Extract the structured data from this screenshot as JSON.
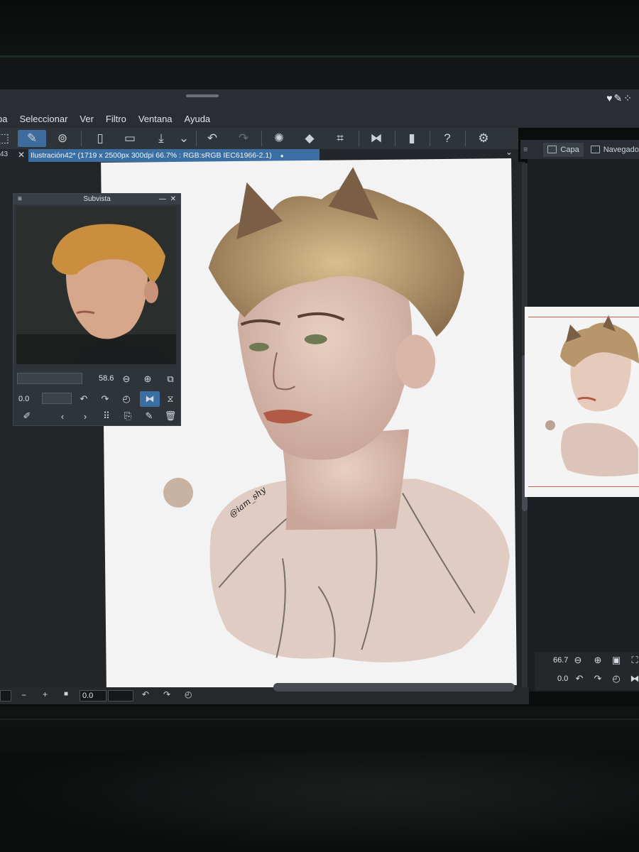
{
  "app": {
    "menu": [
      "pa",
      "Seleccionar",
      "Ver",
      "Filtro",
      "Ventana",
      "Ayuda"
    ]
  },
  "document": {
    "tab_number": "43",
    "tab_title": "Ilustración42* (1719 x 2500px 300dpi 66.7% : RGB:sRGB IEC61966-2.1)"
  },
  "right_panel": {
    "tabs": [
      "Capa",
      "Navegador"
    ],
    "zoom_value": "66.7",
    "rotation_value": "0.0"
  },
  "subview": {
    "title": "Subvista",
    "zoom_value": "58.6",
    "rotation_value": "0.0"
  },
  "statusbar": {
    "minus": "−",
    "plus": "+",
    "rotation_value": "0.0"
  },
  "canvas": {
    "signature": "@iam_shy"
  },
  "toolbar_icons": [
    "crop-icon",
    "edit-icon",
    "record-icon",
    "new-file-icon",
    "open-folder-icon",
    "save-icon",
    "dropdown-icon",
    "undo-icon",
    "redo-icon",
    "loading-icon",
    "fill-icon",
    "transform-icon",
    "flip-icon",
    "device-icon",
    "help-icon",
    "settings-icon"
  ],
  "colors": {
    "accent": "#3b6ea3",
    "chrome": "#2b2f33",
    "canvas": "#f3f3f3"
  }
}
